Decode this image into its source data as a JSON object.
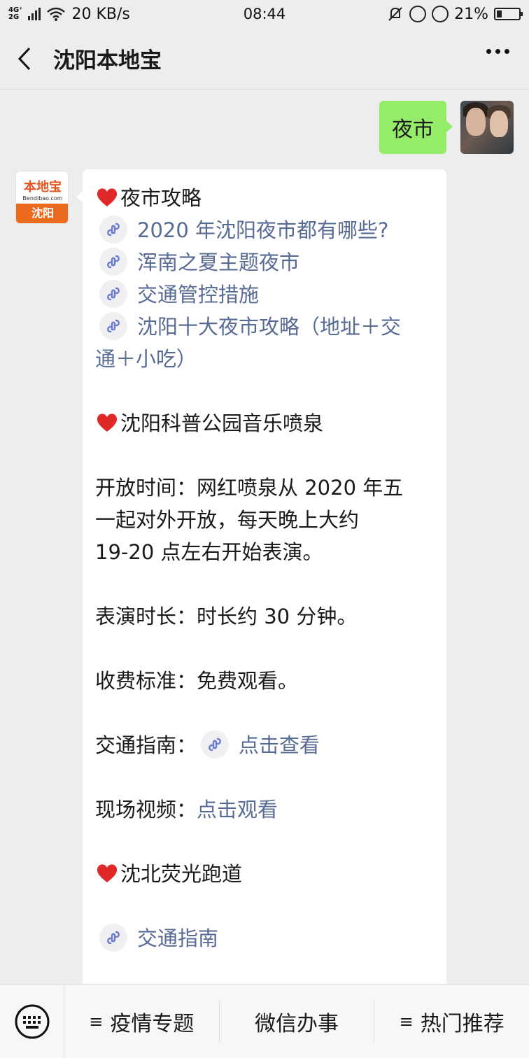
{
  "status_bar": {
    "network": "4G+ 2G",
    "speed": "20 KB/s",
    "time": "08:44",
    "battery": "21%"
  },
  "header": {
    "title": "沈阳本地宝",
    "back_icon": "chevron-left-icon",
    "more_icon": "more-dots-icon"
  },
  "chat": {
    "user_message": "夜市",
    "bot_avatar": {
      "brand_top": "本地宝",
      "brand_url": "Bendibao.com",
      "brand_city": "沈阳"
    },
    "reply": {
      "section1_title": "夜市攻略",
      "links1": [
        "2020 年沈阳夜市都有哪些?",
        "浑南之夏主题夜市",
        "交通管控措施",
        "沈阳十大夜市攻略（地址＋交",
        "通＋小吃）"
      ],
      "section2_title": "沈阳科普公园音乐喷泉",
      "open_time": [
        "开放时间：网红喷泉从 2020 年五",
        "一起对外开放，每天晚上大约",
        "19-20 点左右开始表演。"
      ],
      "duration": "表演时长：时长约 30 分钟。",
      "fee": "收费标准：免费观看。",
      "traffic_label": "交通指南：",
      "traffic_link": "点击查看",
      "video_label": "现场视频：",
      "video_link": "点击观看",
      "section3_title": "沈北荧光跑道",
      "last_link": "交通指南"
    }
  },
  "bottom_menu": {
    "keyboard_icon": "keyboard-icon",
    "items": [
      {
        "label": "疫情专题",
        "glyph": "≡"
      },
      {
        "label": "微信办事",
        "glyph": ""
      },
      {
        "label": "热门推荐",
        "glyph": "≡"
      }
    ]
  },
  "colors": {
    "self_bubble": "#95ec69",
    "link": "#576b95",
    "background": "#ededed"
  }
}
